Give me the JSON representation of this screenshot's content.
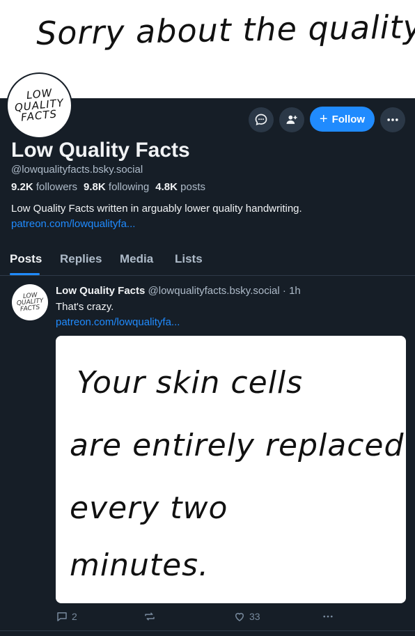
{
  "caption": {
    "text": "Sorry about the quality"
  },
  "profile": {
    "avatar_text": [
      "LOW",
      "QUALITY",
      "FACTS"
    ],
    "display_name": "Low Quality Facts",
    "handle": "@lowqualityfacts.bsky.social",
    "followers_count": "9.2K",
    "followers_label": "followers",
    "following_count": "9.8K",
    "following_label": "following",
    "posts_count": "4.8K",
    "posts_label": "posts",
    "bio": "Low Quality Facts written in arguably lower quality handwriting.",
    "bio_link": "patreon.com/lowqualityfa..."
  },
  "actions": {
    "message_icon": "chat-bubble-icon",
    "add_user_icon": "person-plus-icon",
    "follow_label": "Follow",
    "more_icon": "ellipsis-icon"
  },
  "tabs": [
    {
      "label": "Posts",
      "active": true
    },
    {
      "label": "Replies",
      "active": false
    },
    {
      "label": "Media",
      "active": false
    },
    {
      "label": "Lists",
      "active": false
    }
  ],
  "post": {
    "author_name": "Low Quality Facts",
    "author_handle": "@lowqualityfacts.bsky.social",
    "separator": "·",
    "time": "1h",
    "text": "That's crazy.",
    "link": "patreon.com/lowqualityfa...",
    "image_text_lines": [
      "Your skin cells",
      "are entirely replaced",
      "every two",
      "minutes."
    ],
    "reply_count": "2",
    "like_count": "33"
  },
  "colors": {
    "background": "#161e27",
    "accent": "#208bfe",
    "muted_text": "#aebbc9"
  }
}
